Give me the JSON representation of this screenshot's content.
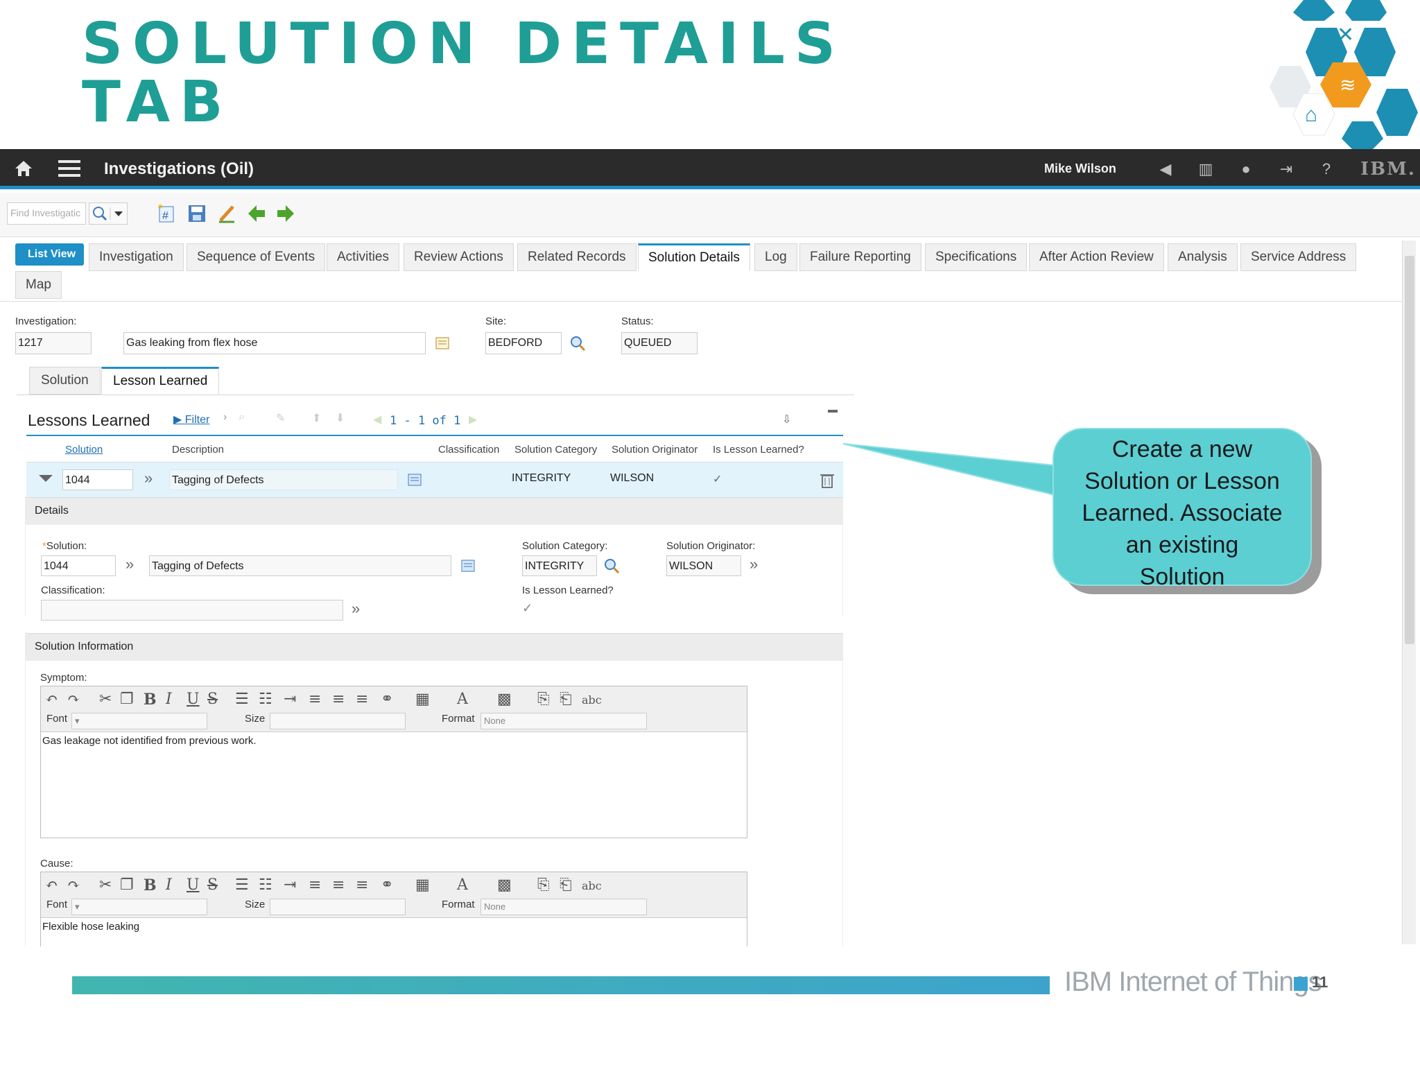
{
  "slide": {
    "title_line1": "Solution Details",
    "title_line2": "Tab"
  },
  "app": {
    "title": "Investigations (Oil)",
    "user": "Mike Wilson",
    "brand_logo": "IBM.",
    "find_placeholder": "Find Investigatic"
  },
  "tabs": [
    "List View",
    "Investigation",
    "Sequence of Events",
    "Activities",
    "Review Actions",
    "Related Records",
    "Solution Details",
    "Log",
    "Failure Reporting",
    "Specifications",
    "After Action Review",
    "Analysis",
    "Service Address",
    "Map"
  ],
  "header": {
    "investigation_label": "Investigation:",
    "investigation_id": "1217",
    "investigation_desc": "Gas leaking from flex hose",
    "site_label": "Site:",
    "site": "BEDFORD",
    "status_label": "Status:",
    "status": "QUEUED"
  },
  "subtabs": [
    "Solution",
    "Lesson Learned"
  ],
  "lessons": {
    "title": "Lessons Learned",
    "filter": "Filter",
    "paging": "1 - 1 of 1",
    "columns": [
      "Solution",
      "Description",
      "Classification",
      "Solution Category",
      "Solution Originator",
      "Is Lesson Learned?"
    ],
    "row": {
      "solution": "1044",
      "description": "Tagging of Defects",
      "category": "INTEGRITY",
      "originator": "WILSON"
    }
  },
  "details": {
    "section": "Details",
    "solution_label": "Solution:",
    "solution": "1044",
    "solution_desc": "Tagging of Defects",
    "category_label": "Solution Category:",
    "category": "INTEGRITY",
    "originator_label": "Solution Originator:",
    "originator": "WILSON",
    "classification_label": "Classification:",
    "lesson_label": "Is Lesson Learned?"
  },
  "solution_info": {
    "section": "Solution Information",
    "symptom_label": "Symptom:",
    "symptom_text": "Gas leakage not identified from previous work.",
    "cause_label": "Cause:",
    "cause_text": "Flexible hose leaking",
    "font_label": "Font",
    "size_label": "Size",
    "format_label": "Format",
    "format_value": "None"
  },
  "callout": {
    "line1": "Create a new",
    "line2": "Solution or Lesson",
    "line3": "Learned. Associate",
    "line4": "an existing",
    "line5": "Solution"
  },
  "footer": {
    "brand": "IBM Internet of Things",
    "page": "11"
  },
  "colors": {
    "title": "#1f9e96",
    "accent": "#1e8fc7",
    "callout": "#5ccfd3",
    "topbar": "#2b2b2b"
  }
}
